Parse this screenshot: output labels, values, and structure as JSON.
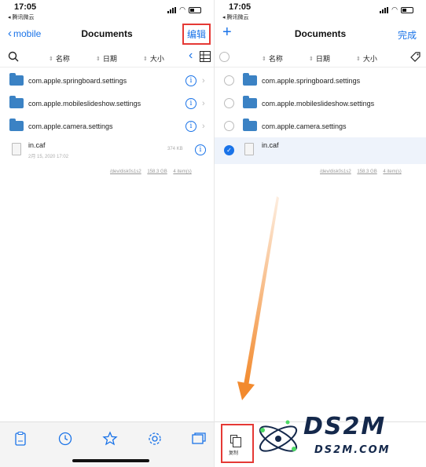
{
  "left": {
    "status": {
      "time": "17:05",
      "carrier": "◂ 腾讯微云"
    },
    "nav": {
      "back": "mobile",
      "title": "Documents",
      "edit": "编辑"
    },
    "toolbar": {
      "sort_name": "名称",
      "sort_date": "日期",
      "sort_size": "大小"
    },
    "folders": [
      {
        "name": "com.apple.springboard.settings"
      },
      {
        "name": "com.apple.mobileslideshow.settings"
      },
      {
        "name": "com.apple.camera.settings"
      }
    ],
    "file": {
      "name": "in.caf",
      "date": "2月 15, 2020 17:02",
      "size": "374 KB"
    },
    "footer": {
      "path": "/dev/disk0s1s2",
      "free": "158.3 GB",
      "count": "4 item(s)"
    }
  },
  "right": {
    "status": {
      "time": "17:05",
      "carrier": "◂ 腾讯微云"
    },
    "nav": {
      "add": "+",
      "title": "Documents",
      "done": "完成"
    },
    "toolbar": {
      "sort_name": "名称",
      "sort_date": "日期",
      "sort_size": "大小"
    },
    "folders": [
      {
        "name": "com.apple.springboard.settings"
      },
      {
        "name": "com.apple.mobileslideshow.settings"
      },
      {
        "name": "com.apple.camera.settings"
      }
    ],
    "file": {
      "name": "in.caf",
      "selected": true
    },
    "footer": {
      "path": "/dev/disk0s1s2",
      "free": "158.3 GB",
      "count": "4 item(s)"
    },
    "copy_label": "复制"
  },
  "watermark": {
    "title": "DS2M",
    "subtitle": "DS2M.COM"
  },
  "colors": {
    "accent": "#1a73e8",
    "highlight": "#e53935",
    "arrow": "#f28a2e"
  },
  "icons": [
    "search-icon",
    "grid-view-icon",
    "info-icon",
    "chevron-right-icon",
    "tag-icon",
    "clipboard-icon",
    "clock-icon",
    "star-icon",
    "gear-icon",
    "windows-icon",
    "copy-icon"
  ]
}
